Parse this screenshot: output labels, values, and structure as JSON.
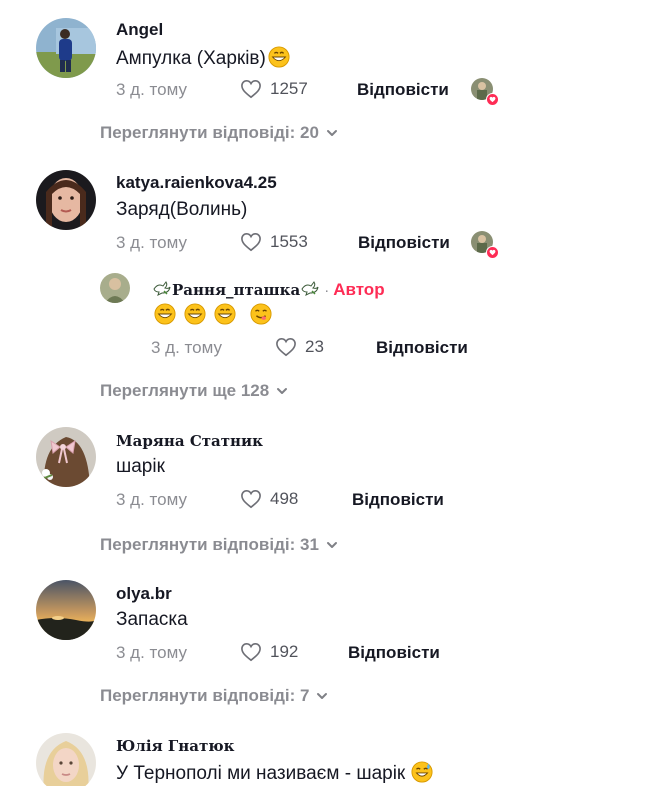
{
  "comments": [
    {
      "username": "Angel",
      "text": "Ампулка (Харків)",
      "time": "3 д. тому",
      "likes": "1257",
      "reply_label": "Відповісти",
      "view_replies": "Переглянути відповіді: 20"
    },
    {
      "username": "katya.raienkova4.25",
      "text": "Заряд(Волинь)",
      "time": "3 д. тому",
      "likes": "1553",
      "reply_label": "Відповісти",
      "reply": {
        "username": "Рання_пташка",
        "author_label": "Автор",
        "time": "3 д. тому",
        "likes": "23",
        "reply_label": "Відповісти"
      },
      "view_replies": "Переглянути ще 128"
    },
    {
      "username": "Маряна Статник",
      "text": "шарік",
      "time": "3 д. тому",
      "likes": "498",
      "reply_label": "Відповісти",
      "view_replies": "Переглянути відповіді: 31"
    },
    {
      "username": "olya.br",
      "text": "Запаска",
      "time": "3 д. тому",
      "likes": "192",
      "reply_label": "Відповісти",
      "view_replies": "Переглянути відповіді: 7"
    },
    {
      "username": "Юлія Гнатюк",
      "text": "У Тернополі ми називаєм - шарік"
    }
  ],
  "colors": {
    "accent": "#fe2c55",
    "text_primary": "#161823",
    "text_secondary": "rgba(22,24,35,0.5)"
  },
  "icons": [
    "heart-icon",
    "chevron-down-icon",
    "grin-emoji",
    "yum-emoji",
    "sweat-smile-emoji",
    "dove-icon",
    "liked-by-author-badge"
  ]
}
